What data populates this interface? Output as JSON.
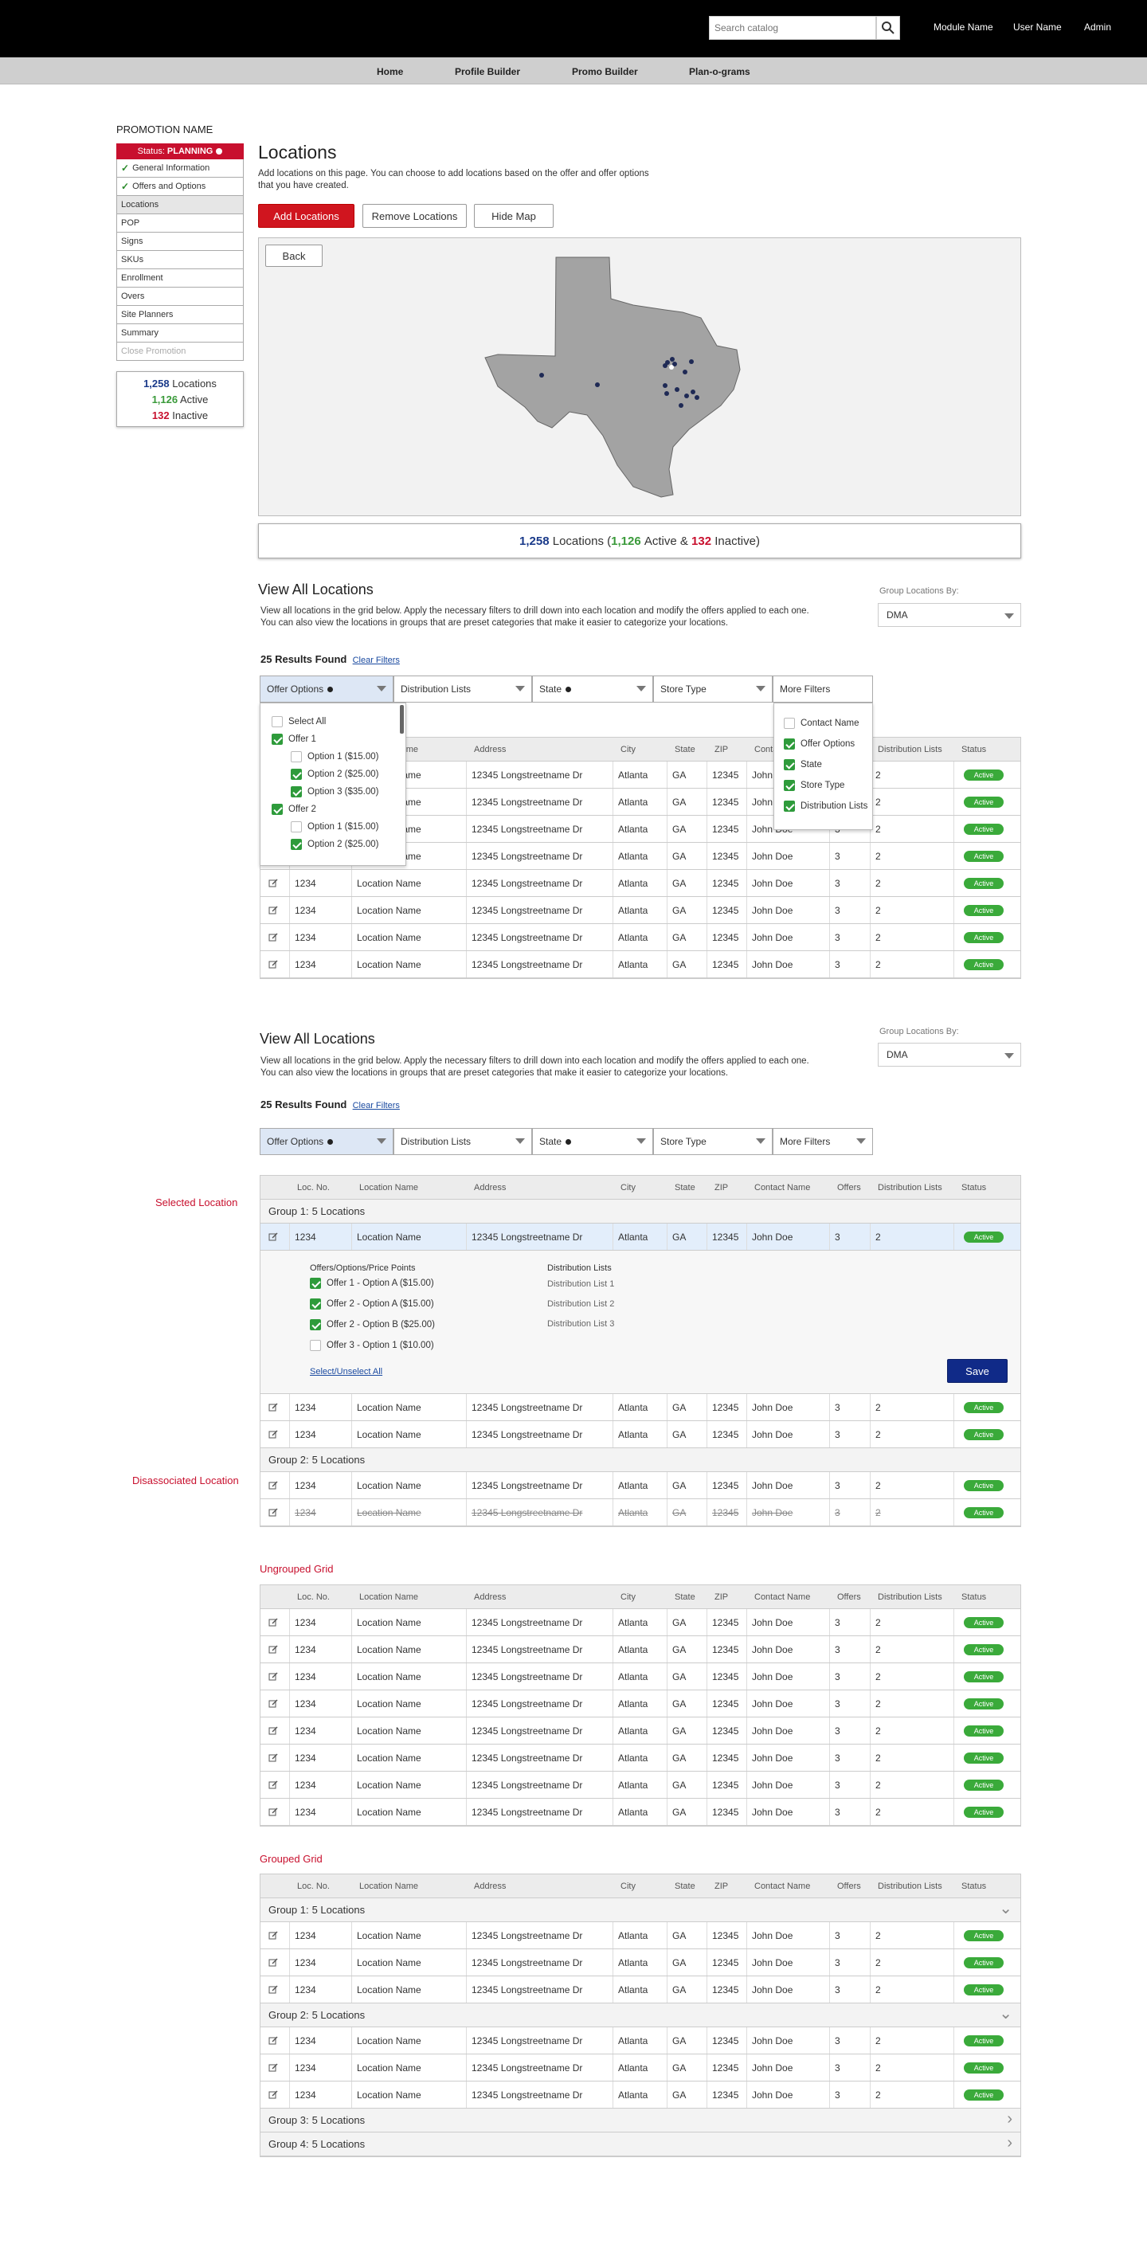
{
  "header": {
    "search_placeholder": "Search catalog",
    "links": [
      "Module Name",
      "User Name",
      "Admin"
    ]
  },
  "nav": [
    "Home",
    "Profile Builder",
    "Promo Builder",
    "Plan-o-grams"
  ],
  "sidebar": {
    "promotion_name": "PROMOTION NAME",
    "status_label": "Status:",
    "status_value": "PLANNING",
    "items": [
      {
        "label": "General Information",
        "state": "done"
      },
      {
        "label": "Offers and Options",
        "state": "done"
      },
      {
        "label": "Locations",
        "state": "active"
      },
      {
        "label": "POP",
        "state": "normal"
      },
      {
        "label": "Signs",
        "state": "normal"
      },
      {
        "label": "SKUs",
        "state": "normal"
      },
      {
        "label": "Enrollment",
        "state": "normal"
      },
      {
        "label": "Overs",
        "state": "normal"
      },
      {
        "label": "Site Planners",
        "state": "normal"
      },
      {
        "label": "Summary",
        "state": "normal"
      },
      {
        "label": "Close Promotion",
        "state": "disabled"
      }
    ],
    "counts": {
      "total": "1,258",
      "total_label": "Locations",
      "active": "1,126",
      "active_label": "Active",
      "inactive": "132",
      "inactive_label": "Inactive"
    }
  },
  "page": {
    "title": "Locations",
    "description": "Add locations on this page. You can choose to add locations based on the offer and offer options that you have created.",
    "add_button": "Add Locations",
    "remove_button": "Remove Locations",
    "hide_map_button": "Hide Map",
    "back_button": "Back",
    "summary": {
      "total": "1,258",
      "locations": "Locations (",
      "active": "1,126",
      "active_label": "Active &",
      "inactive": "132",
      "inactive_label": "Inactive)"
    }
  },
  "view_all": {
    "title": "View All Locations",
    "description": "View all locations in the grid below. Apply the necessary filters to drill down into each location and modify the offers applied to each one. You can also view the locations in groups that are preset categories that make it easier to categorize your locations.",
    "group_by_label": "Group Locations By:",
    "group_by_value": "DMA",
    "results": "25 Results Found",
    "clear_filters": "Clear Filters",
    "filters": [
      "Offer Options",
      "Distribution Lists",
      "State",
      "Store Type",
      "More Filters"
    ]
  },
  "offer_dropdown": [
    {
      "label": "Select All",
      "checked": false,
      "indent": 0
    },
    {
      "label": "Offer 1",
      "checked": true,
      "indent": 0
    },
    {
      "label": "Option 1 ($15.00)",
      "checked": false,
      "indent": 1
    },
    {
      "label": "Option 2 ($25.00)",
      "checked": true,
      "indent": 1
    },
    {
      "label": "Option 3 ($35.00)",
      "checked": true,
      "indent": 1
    },
    {
      "label": "Offer 2",
      "checked": true,
      "indent": 0
    },
    {
      "label": "Option 1 ($15.00)",
      "checked": false,
      "indent": 1
    },
    {
      "label": "Option 2 ($25.00)",
      "checked": true,
      "indent": 1
    }
  ],
  "more_filters": [
    {
      "label": "Contact Name",
      "checked": false
    },
    {
      "label": "Offer Options",
      "checked": true
    },
    {
      "label": "State",
      "checked": true
    },
    {
      "label": "Store Type",
      "checked": true
    },
    {
      "label": "Distribution Lists",
      "checked": true
    }
  ],
  "columns": [
    "Loc. No.",
    "Location Name",
    "Address",
    "City",
    "State",
    "ZIP",
    "Contact Name",
    "Offers",
    "Distribution Lists",
    "Status"
  ],
  "row": {
    "loc": "1234",
    "name": "Location Name",
    "address": "12345 Longstreetname Dr",
    "city": "Atlanta",
    "state": "GA",
    "zip": "12345",
    "contact": "John Doe",
    "offers": "3",
    "lists": "2",
    "status": "Active"
  },
  "annotations": {
    "selected": "Selected Location",
    "disassociated": "Disassociated Location",
    "ungrouped": "Ungrouped Grid",
    "grouped": "Grouped Grid"
  },
  "groups": {
    "g1": "Group 1:",
    "g2": "Group 2:",
    "g3": "Group 3:",
    "g4": "Group 4:",
    "count": "5 Locations"
  },
  "expanded": {
    "offers_title": "Offers/Options/Price Points",
    "offers": [
      {
        "label": "Offer 1 - Option A ($15.00)",
        "checked": true
      },
      {
        "label": "Offer 2 - Option A ($15.00)",
        "checked": true
      },
      {
        "label": "Offer 2 - Option B ($25.00)",
        "checked": true
      },
      {
        "label": "Offer 3 - Option 1 ($10.00)",
        "checked": false
      }
    ],
    "lists_title": "Distribution Lists",
    "lists": [
      "Distribution List 1",
      "Distribution List 2",
      "Distribution List 3"
    ],
    "select_all": "Select/Unselect All",
    "save": "Save"
  },
  "colors": {
    "brand_red": "#d0151f",
    "navy": "#102a88",
    "active_green": "#3aaa3a"
  }
}
